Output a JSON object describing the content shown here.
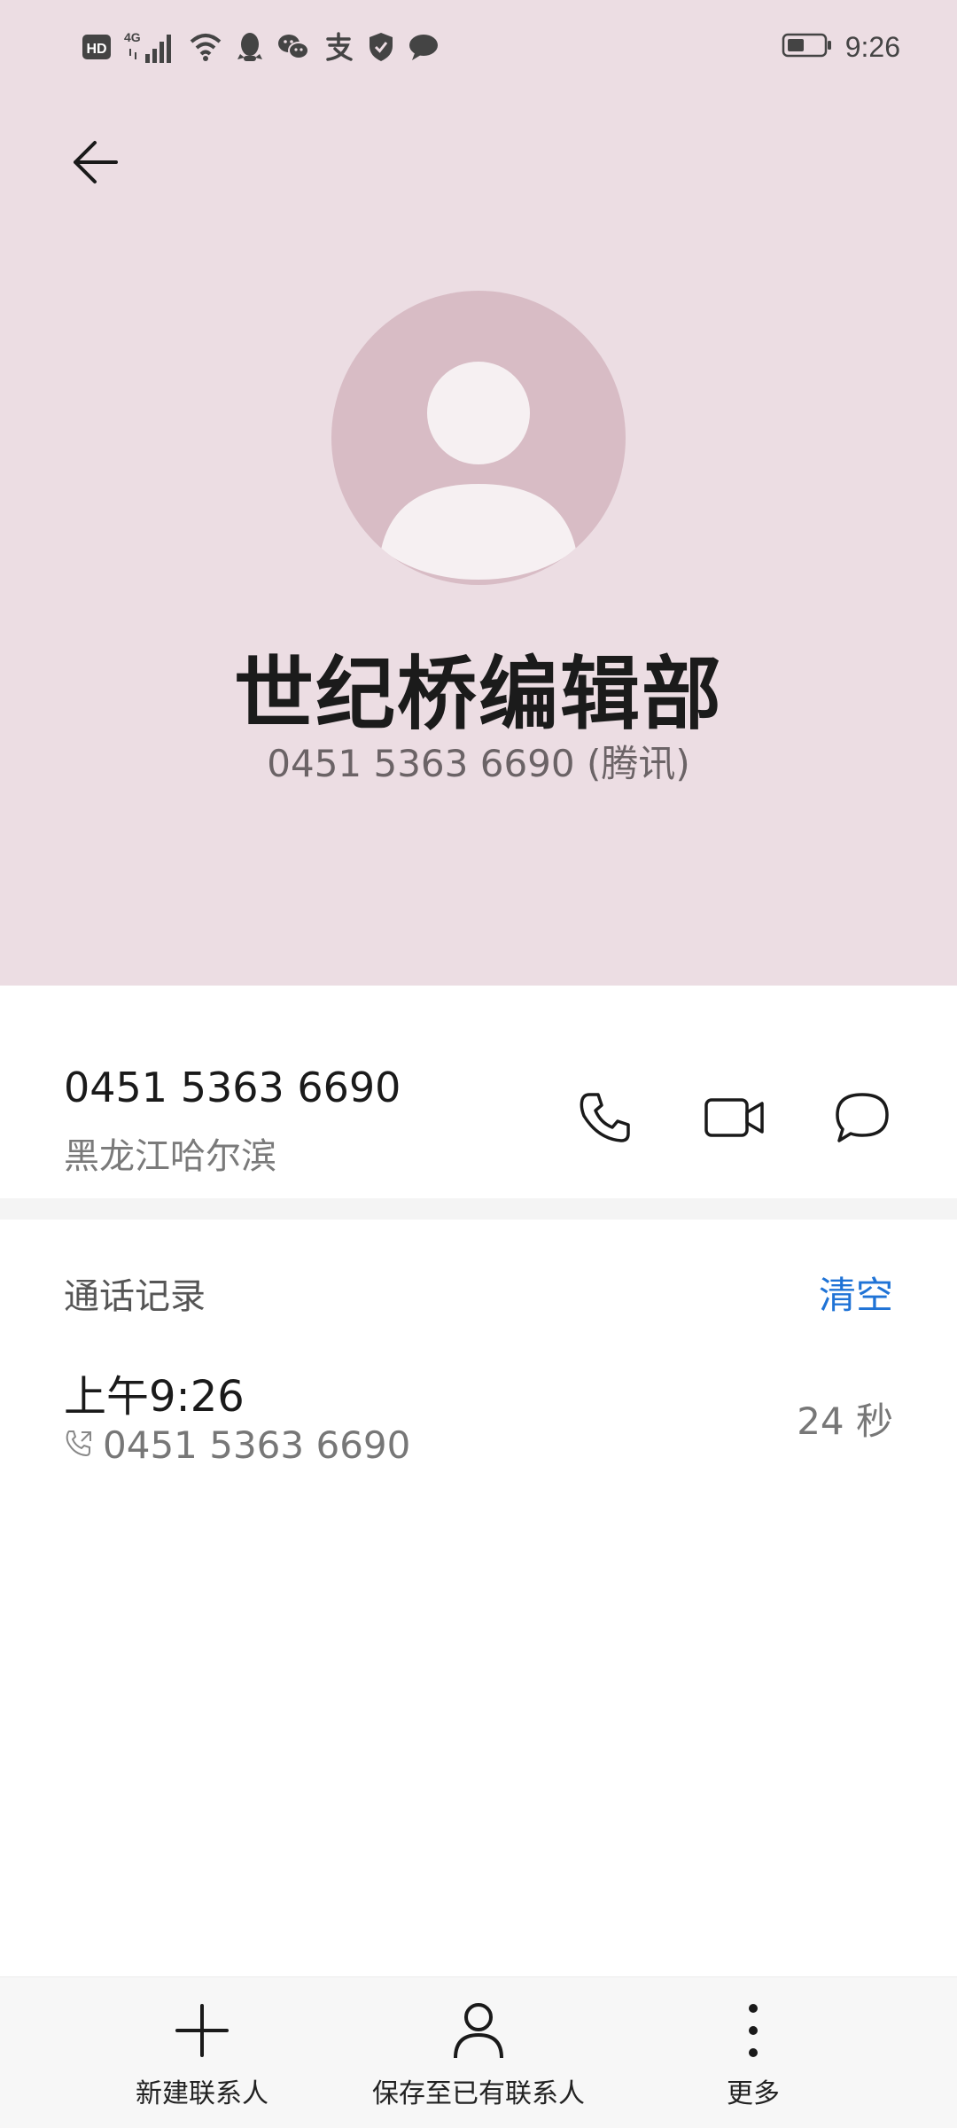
{
  "status_bar": {
    "time": "9:26",
    "icons": [
      "hd-icon",
      "4g-signal-icon",
      "wifi-icon",
      "qq-icon",
      "wechat-icon",
      "alipay-icon",
      "shield-icon",
      "message-icon",
      "battery-icon"
    ],
    "hd_label": "HD",
    "network_label": "4G"
  },
  "contact": {
    "name": "世纪桥编辑部",
    "subtitle": "0451 5363 6690 (腾讯)",
    "number": "0451 5363 6690",
    "location": "黑龙江哈尔滨"
  },
  "call_log": {
    "title": "通话记录",
    "clear_label": "清空",
    "entries": [
      {
        "time": "上午9:26",
        "number": "0451 5363 6690",
        "duration": "24 秒"
      }
    ]
  },
  "bottom_bar": {
    "new_contact": "新建联系人",
    "save_existing": "保存至已有联系人",
    "more": "更多"
  },
  "colors": {
    "header_bg": "#ecdde3",
    "avatar_bg": "#d8bcc5",
    "accent": "#1f73d6"
  }
}
